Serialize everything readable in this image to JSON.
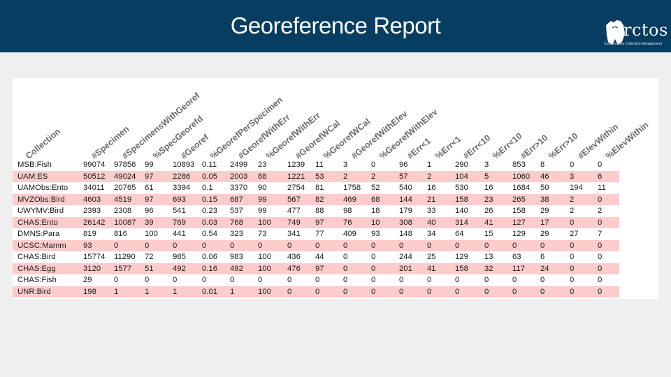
{
  "slide": {
    "title": "Georeference Report"
  },
  "logo": {
    "name": "rctos",
    "tagline": "Collaborative Collection Management"
  },
  "colors": {
    "header": "#073d61",
    "row_pink": "#ffcccc",
    "header_text": "#6a6a6a"
  },
  "table": {
    "columns": [
      "Collection",
      "#Specimen",
      "#SpecimensWithGeoref",
      "%SpecGeorefd",
      "#Georef",
      "%GeorefPerSpecimen",
      "#GeorefWithErr",
      "%GeorefWithErr",
      "#GeorefWCal",
      "%GeorefWCal",
      "#GeorefWithElev",
      "%GeorefWithElev",
      "#Err<1",
      "%Err<1",
      "#Err<10",
      "%Err<10",
      "#Err>10",
      "%Err>10",
      "#ElevWithin",
      "%ElevWithin"
    ],
    "rows": [
      [
        "MSB:Fish",
        "99074",
        "97856",
        "99",
        "10893",
        "0.11",
        "2499",
        "23",
        "1239",
        "11",
        "3",
        "0",
        "96",
        "1",
        "290",
        "3",
        "853",
        "8",
        "0",
        "0"
      ],
      [
        "UAM:ES",
        "50512",
        "49024",
        "97",
        "2286",
        "0.05",
        "2003",
        "88",
        "1221",
        "53",
        "2",
        "2",
        "57",
        "2",
        "104",
        "5",
        "1060",
        "46",
        "3",
        "6"
      ],
      [
        "UAMObs:Ento",
        "34011",
        "20765",
        "61",
        "3394",
        "0.1",
        "3370",
        "90",
        "2754",
        "81",
        "1758",
        "52",
        "540",
        "16",
        "530",
        "16",
        "1684",
        "50",
        "194",
        "11"
      ],
      [
        "MVZObs:Bird",
        "4603",
        "4519",
        "97",
        "693",
        "0.15",
        "687",
        "99",
        "567",
        "82",
        "469",
        "68",
        "144",
        "21",
        "158",
        "23",
        "265",
        "38",
        "2",
        "0"
      ],
      [
        "UWYMV:Bird",
        "2393",
        "2308",
        "96",
        "541",
        "0.23",
        "537",
        "99",
        "477",
        "88",
        "98",
        "18",
        "179",
        "33",
        "140",
        "26",
        "158",
        "29",
        "2",
        "2"
      ],
      [
        "CHAS:Ento",
        "26142",
        "10087",
        "39",
        "769",
        "0.03",
        "768",
        "100",
        "749",
        "97",
        "76",
        "10",
        "308",
        "40",
        "314",
        "41",
        "127",
        "17",
        "0",
        "0"
      ],
      [
        "DMNS:Para",
        "819",
        "816",
        "100",
        "441",
        "0.54",
        "323",
        "73",
        "341",
        "77",
        "409",
        "93",
        "148",
        "34",
        "64",
        "15",
        "129",
        "29",
        "27",
        "7"
      ],
      [
        "UCSC:Mamm",
        "93",
        "0",
        "0",
        "0",
        "0",
        "0",
        "0",
        "0",
        "0",
        "0",
        "0",
        "0",
        "0",
        "0",
        "0",
        "0",
        "0",
        "0",
        "0"
      ],
      [
        "CHAS:Bird",
        "15774",
        "11290",
        "72",
        "985",
        "0.06",
        "983",
        "100",
        "436",
        "44",
        "0",
        "0",
        "244",
        "25",
        "129",
        "13",
        "63",
        "6",
        "0",
        "0"
      ],
      [
        "CHAS:Egg",
        "3120",
        "1577",
        "51",
        "492",
        "0.16",
        "492",
        "100",
        "476",
        "97",
        "0",
        "0",
        "201",
        "41",
        "158",
        "32",
        "117",
        "24",
        "0",
        "0"
      ],
      [
        "CHAS:Fish",
        "29",
        "0",
        "0",
        "0",
        "0",
        "0",
        "0",
        "0",
        "0",
        "0",
        "0",
        "0",
        "0",
        "0",
        "0",
        "0",
        "0",
        "0",
        "0"
      ],
      [
        "UNR:Bird",
        "198",
        "1",
        "1",
        "1",
        "0.01",
        "1",
        "100",
        "0",
        "0",
        "0",
        "0",
        "0",
        "0",
        "0",
        "0",
        "0",
        "0",
        "0",
        "0"
      ]
    ]
  }
}
